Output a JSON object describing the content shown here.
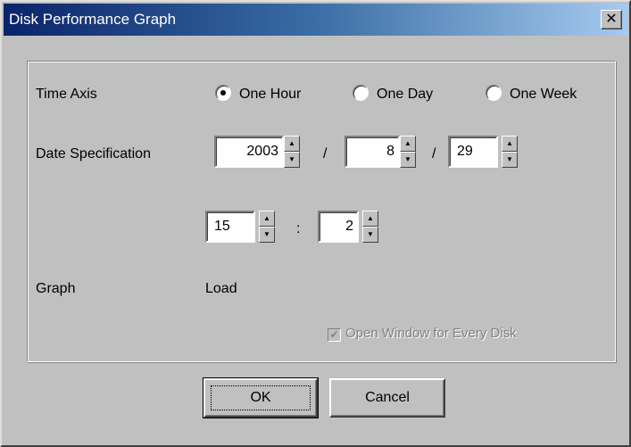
{
  "window": {
    "title": "Disk Performance Graph",
    "close_glyph": "✕"
  },
  "time_axis": {
    "label": "Time Axis",
    "options": [
      {
        "label": "One Hour",
        "selected": true
      },
      {
        "label": "One Day",
        "selected": false
      },
      {
        "label": "One Week",
        "selected": false
      }
    ]
  },
  "date_spec": {
    "label": "Date Specification",
    "year": "2003",
    "month": "8",
    "day": "29",
    "separator": "/"
  },
  "time_spec": {
    "hour": "15",
    "minute": "2",
    "separator": ":"
  },
  "graph": {
    "label": "Graph",
    "value": "Load"
  },
  "open_window_checkbox": {
    "label": "Open Window for Every Disk",
    "checked": true,
    "enabled": false
  },
  "buttons": {
    "ok": "OK",
    "cancel": "Cancel"
  },
  "colors": {
    "face": "#c0c0c0",
    "title_start": "#0a246a",
    "title_end": "#a6caf0",
    "disabled_text": "#808080"
  }
}
